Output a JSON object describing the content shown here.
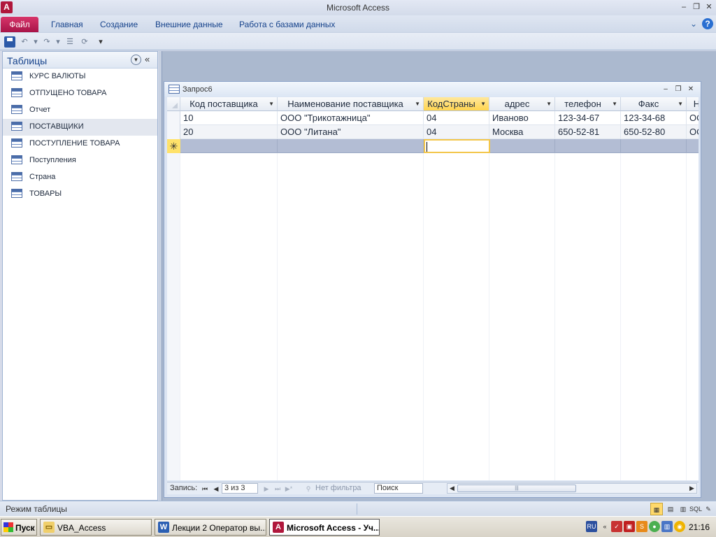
{
  "window": {
    "title": "Microsoft Access",
    "app_icon": "A"
  },
  "ribbon": {
    "file_tab": "Файл",
    "tabs": [
      "Главная",
      "Создание",
      "Внешние данные",
      "Работа с базами данных"
    ]
  },
  "nav": {
    "title": "Таблицы",
    "items": [
      {
        "label": "КУРС ВАЛЮТЫ",
        "selected": false
      },
      {
        "label": "ОТПУЩЕНО ТОВАРА",
        "selected": false
      },
      {
        "label": "Отчет",
        "selected": false
      },
      {
        "label": "ПОСТАВЩИКИ",
        "selected": true
      },
      {
        "label": "ПОСТУПЛЕНИЕ ТОВАРА",
        "selected": false
      },
      {
        "label": "Поступления",
        "selected": false
      },
      {
        "label": "Страна",
        "selected": false
      },
      {
        "label": "ТОВАРЫ",
        "selected": false
      }
    ]
  },
  "query": {
    "title": "Запрос6",
    "columns": [
      "Код поставщика",
      "Наименование поставщика",
      "КодСтраны",
      "адрес",
      "телефон",
      "Факс",
      "Н"
    ],
    "active_column": "КодСтраны",
    "rows": [
      [
        "10",
        "ООО \"Трикотажница\"",
        "04",
        "Иваново",
        "123-34-67",
        "123-34-68",
        "ОО"
      ],
      [
        "20",
        "ООО \"Литана\"",
        "04",
        "Москва",
        "650-52-81",
        "650-52-80",
        "ОО"
      ]
    ],
    "new_row_marker": "✳"
  },
  "record_nav": {
    "label": "Запись:",
    "position": "3 из 3",
    "filter": "Нет фильтра",
    "search_placeholder": "Поиск"
  },
  "status": {
    "mode": "Режим таблицы",
    "sql_label": "SQL"
  },
  "taskbar": {
    "start": "Пуск",
    "tasks": [
      {
        "label": "VBA_Access",
        "icon": "folder-icon",
        "active": false
      },
      {
        "label": "Лекции 2 Оператор вы...",
        "icon": "word-icon",
        "active": false
      },
      {
        "label": "Microsoft Access - Уч...",
        "icon": "access-icon",
        "active": true
      }
    ],
    "lang": "RU",
    "clock": "21:16"
  },
  "colors": {
    "accent_file": "#b0173c",
    "active_header": "#ffd54f",
    "new_row": "#b3bdd4"
  }
}
